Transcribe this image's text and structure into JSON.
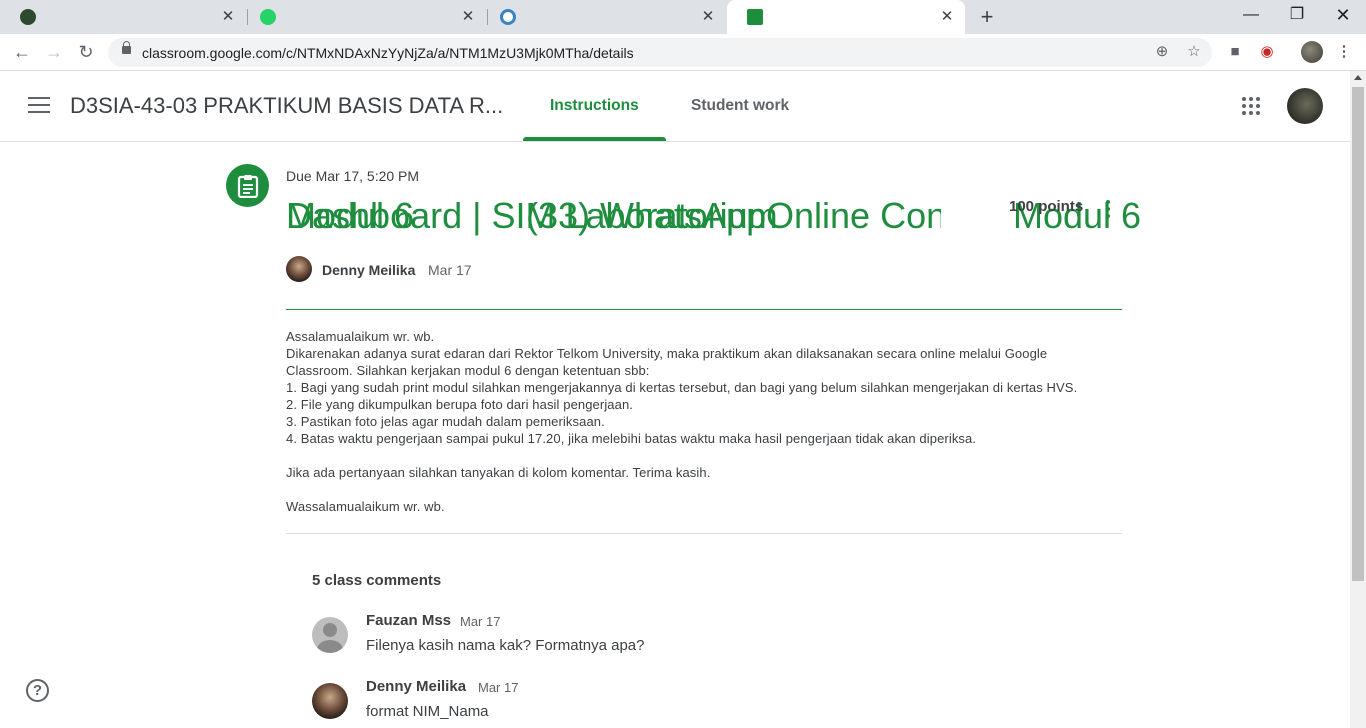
{
  "browser": {
    "tabs": [
      {
        "title": "Dashboard | SIM Laboratorium",
        "favicon_color": "#2e4a2e"
      },
      {
        "title": "(33) WhatsApp",
        "favicon_color": "#25d366"
      },
      {
        "title": "Online Converter - Convert Imag",
        "favicon_color": "#3b82c4"
      },
      {
        "title": "Modul 6",
        "favicon_color": "#1e8e3e"
      }
    ],
    "url": "classroom.google.com/c/NTMxNDAxNzYyNjZa/a/NTM1MzU3Mjk0MTha/details"
  },
  "classroom": {
    "class_name": "D3SIA-43-03 PRAKTIKUM BASIS DATA R...",
    "tabs": [
      "Instructions",
      "Student work"
    ],
    "active_tab": "Instructions"
  },
  "assignment": {
    "due": "Due Mar 17, 5:20 PM",
    "title": "Modul 6",
    "points": "100 points",
    "author": "Denny Meilika",
    "posted_date": "Mar 17",
    "body_lines": [
      "Assalamualaikum wr. wb.",
      "Dikarenakan adanya surat edaran dari Rektor Telkom University, maka praktikum akan dilaksanakan secara online melalui Google",
      "Classroom. Silahkan kerjakan modul 6 dengan ketentuan sbb:",
      "1. Bagi yang sudah print modul silahkan mengerjakannya di kertas tersebut, dan bagi yang belum silahkan mengerjakan di kertas HVS.",
      "2. File yang dikumpulkan berupa foto dari hasil pengerjaan.",
      "3. Pastikan foto jelas agar mudah dalam pemeriksaan.",
      "4. Batas waktu pengerjaan sampai pukul 17.20, jika melebihi batas waktu maka hasil pengerjaan tidak akan diperiksa.",
      "",
      "Jika ada pertanyaan silahkan tanyakan di kolom komentar. Terima kasih.",
      "",
      "Wassalamualaikum wr. wb."
    ]
  },
  "comments": {
    "header": "5 class comments",
    "items": [
      {
        "name": "Fauzan Mss",
        "date": "Mar 17",
        "text": "Filenya kasih nama kak? Formatnya apa?"
      },
      {
        "name": "Denny Meilika",
        "date": "Mar 17",
        "text": "format NIM_Nama"
      }
    ]
  },
  "colors": {
    "accent": "#1e8e3e",
    "text": "#3c4043"
  }
}
